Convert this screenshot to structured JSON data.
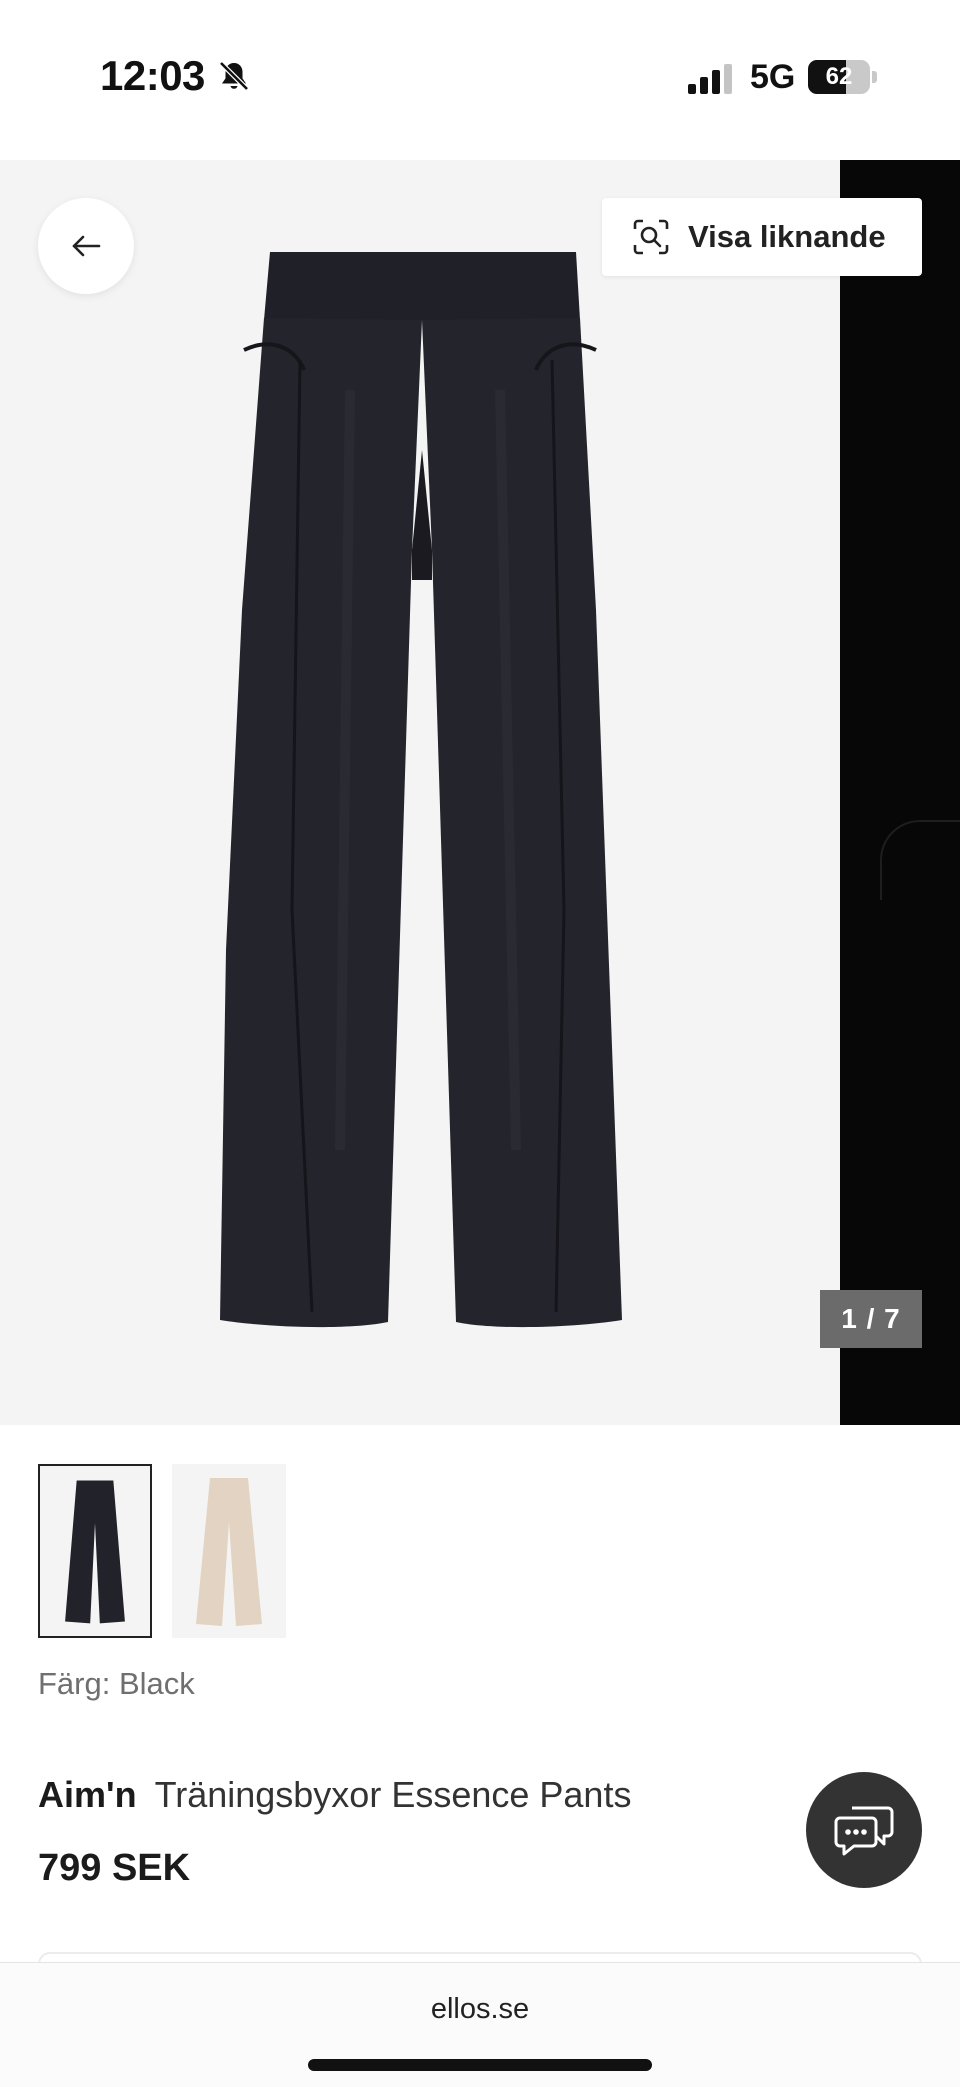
{
  "status_bar": {
    "time": "12:03",
    "network": "5G",
    "battery_level": 62,
    "battery_text": "62",
    "icons": [
      "bell-off-icon",
      "signal-icon",
      "battery-icon"
    ]
  },
  "gallery": {
    "visa_liknande_label": "Visa liknande",
    "counter": "1 / 7",
    "current_image": 1,
    "total_images": 7,
    "back_icon": "arrow-left-icon",
    "visa_icon": "visual-search-icon"
  },
  "colors": {
    "label": "Färg: Black",
    "swatches": [
      {
        "name": "Black",
        "hex": "#22222a",
        "selected": true
      },
      {
        "name": "Beige",
        "hex": "#e3d3c3",
        "selected": false
      }
    ]
  },
  "product": {
    "brand": "Aim'n",
    "name": "Träningsbyxor Essence Pants",
    "price": "799 SEK"
  },
  "chat": {
    "icon": "chat-bubbles-icon"
  },
  "browser": {
    "url": "ellos.se"
  },
  "palette": {
    "accent_dark": "#333333",
    "gallery_bg": "#f4f4f4",
    "product_black": "#22222a",
    "product_beige": "#e3d3c3"
  }
}
